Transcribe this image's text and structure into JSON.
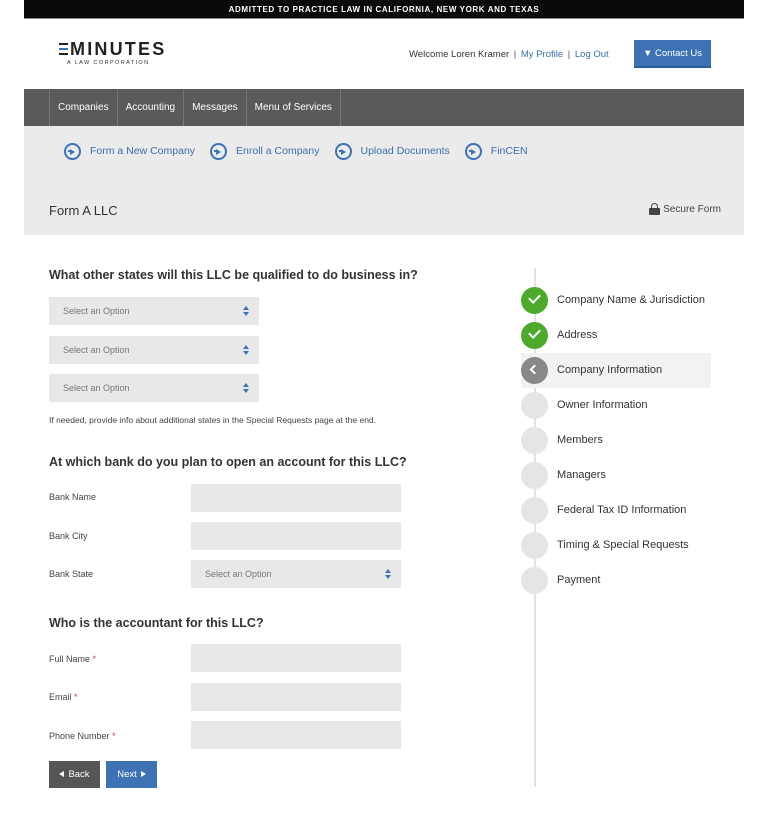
{
  "topbar": {
    "text": "ADMITTED TO PRACTICE LAW IN CALIFORNIA, NEW YORK AND TEXAS"
  },
  "header": {
    "logo_word": "MINUTES",
    "logo_sub": "A LAW CORPORATION",
    "welcome_text": "Welcome Loren Kramer",
    "separator": "|",
    "my_profile": "My Profile",
    "log_out": "Log Out",
    "contact_label": "▼ Contact Us"
  },
  "main_nav": {
    "items": [
      "Companies",
      "Accounting",
      "Messages",
      "Menu of Services"
    ]
  },
  "sub_nav": {
    "items": [
      "Form a New Company",
      "Enroll a Company",
      "Upload Documents",
      "FinCEN"
    ]
  },
  "form_header": {
    "title": "Form A LLC",
    "secure_label": "Secure Form"
  },
  "form": {
    "states_question": "What other states will this LLC be qualified to do business in?",
    "state_selects": [
      "Select an Option",
      "Select an Option",
      "Select an Option"
    ],
    "states_note": "If needed, provide info about additional states in the Special Requests page at the end.",
    "bank_question": "At which bank do you plan to open an account for this LLC?",
    "bank_name_label": "Bank Name",
    "bank_name_value": "",
    "bank_city_label": "Bank City",
    "bank_city_value": "",
    "bank_state_label": "Bank State",
    "bank_state_value": "Select an Option",
    "accountant_question": "Who is the accountant for this LLC?",
    "full_name_label": "Full Name",
    "email_label": "Email",
    "phone_label": "Phone Number",
    "required_mark": "*",
    "full_name_value": "",
    "email_value": "",
    "phone_value": "",
    "back_label": "Back",
    "next_label": "Next"
  },
  "steps": [
    {
      "label": "Company Name & Jurisdiction",
      "status": "done"
    },
    {
      "label": "Address",
      "status": "done"
    },
    {
      "label": "Company Information",
      "status": "current"
    },
    {
      "label": "Owner Information",
      "status": "pending"
    },
    {
      "label": "Members",
      "status": "pending"
    },
    {
      "label": "Managers",
      "status": "pending"
    },
    {
      "label": "Federal Tax ID Information",
      "status": "pending"
    },
    {
      "label": "Timing & Special Requests",
      "status": "pending"
    },
    {
      "label": "Payment",
      "status": "pending"
    }
  ],
  "colors": {
    "brand_blue": "#3d72b4",
    "nav_gray": "#5a5a5a",
    "done_green": "#4caa2b",
    "current_gray": "#888888",
    "required_red": "#dd3333"
  }
}
